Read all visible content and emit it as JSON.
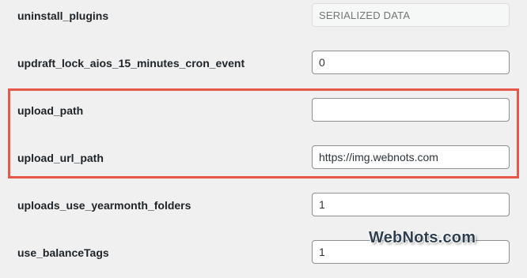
{
  "options": [
    {
      "name": "uninstall_plugins",
      "value": "",
      "placeholder": "SERIALIZED DATA",
      "disabled": true
    },
    {
      "name": "updraft_lock_aios_15_minutes_cron_event",
      "value": "0",
      "placeholder": "",
      "disabled": false
    },
    {
      "name": "upload_path",
      "value": "",
      "placeholder": "",
      "disabled": false
    },
    {
      "name": "upload_url_path",
      "value": "https://img.webnots.com",
      "placeholder": "",
      "disabled": false
    },
    {
      "name": "uploads_use_yearmonth_folders",
      "value": "1",
      "placeholder": "",
      "disabled": false
    },
    {
      "name": "use_balanceTags",
      "value": "1",
      "placeholder": "",
      "disabled": false
    }
  ],
  "highlight": {
    "color": "#e8584a"
  },
  "watermark": {
    "text": "WebNots.com"
  }
}
